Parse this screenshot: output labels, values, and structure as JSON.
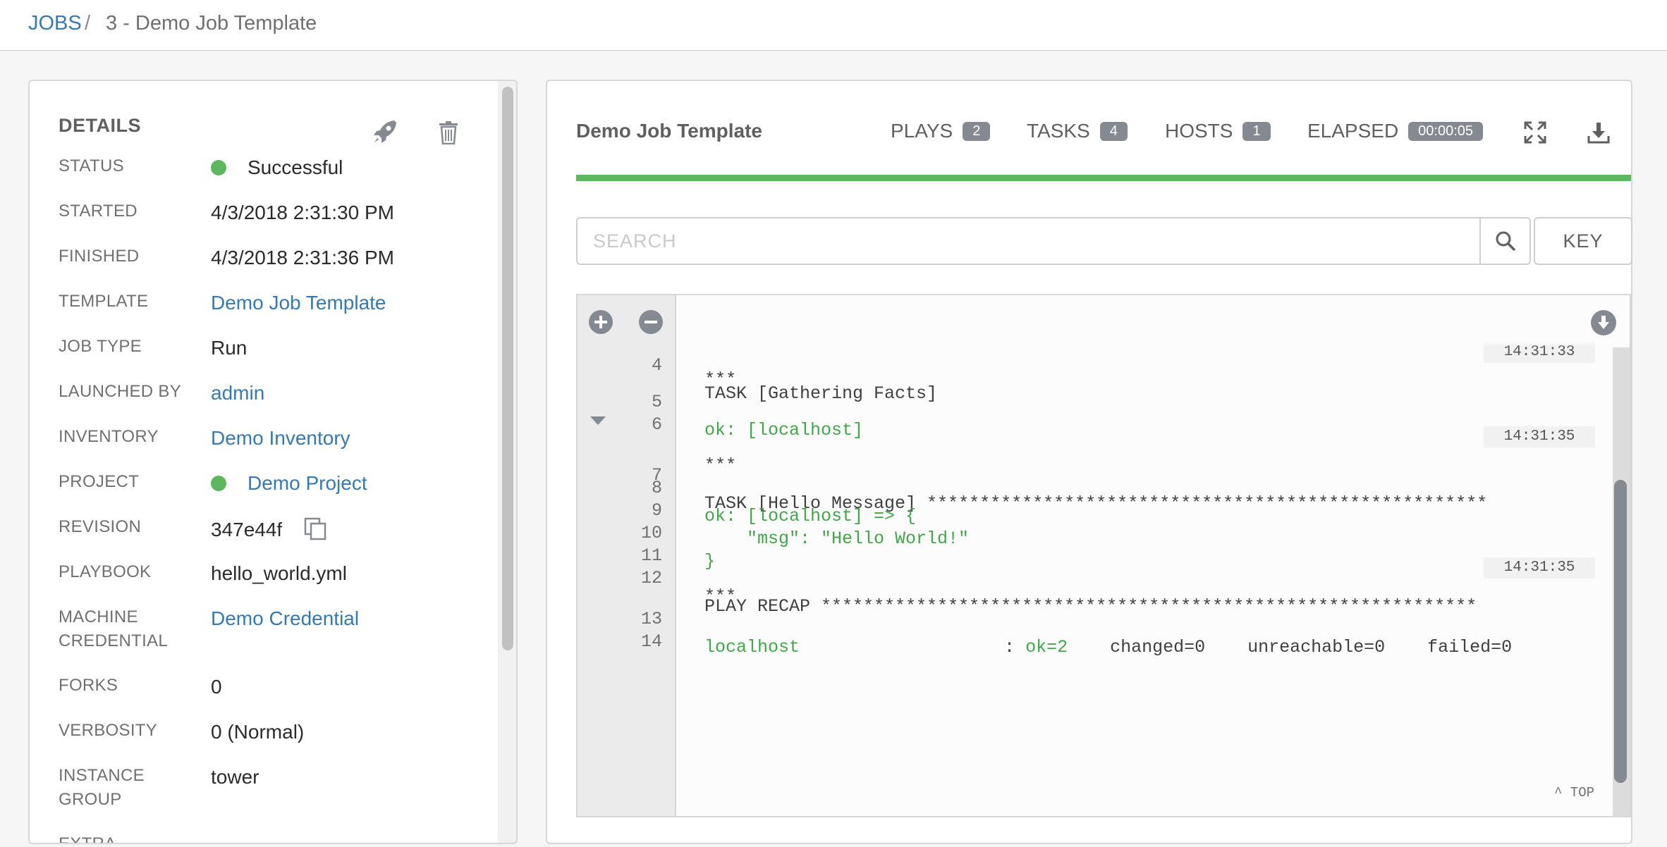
{
  "breadcrumb": {
    "root": "JOBS",
    "separator": "/",
    "current": "3 - Demo Job Template"
  },
  "details": {
    "title": "DETAILS",
    "rows": [
      {
        "label": "STATUS",
        "value": "Successful"
      },
      {
        "label": "STARTED",
        "value": "4/3/2018 2:31:30 PM"
      },
      {
        "label": "FINISHED",
        "value": "4/3/2018 2:31:36 PM"
      },
      {
        "label": "TEMPLATE",
        "value": "Demo Job Template"
      },
      {
        "label": "JOB TYPE",
        "value": "Run"
      },
      {
        "label": "LAUNCHED BY",
        "value": "admin"
      },
      {
        "label": "INVENTORY",
        "value": "Demo Inventory"
      },
      {
        "label": "PROJECT",
        "value": "Demo Project"
      },
      {
        "label": "REVISION",
        "value": "347e44f"
      },
      {
        "label": "PLAYBOOK",
        "value": "hello_world.yml"
      },
      {
        "label": "MACHINE CREDENTIAL",
        "value": "Demo Credential"
      },
      {
        "label": "FORKS",
        "value": "0"
      },
      {
        "label": "VERBOSITY",
        "value": "0 (Normal)"
      },
      {
        "label": "INSTANCE GROUP",
        "value": "tower"
      },
      {
        "label": "EXTRA VARIABLES",
        "value": ""
      }
    ]
  },
  "output": {
    "title": "Demo Job Template",
    "stats": [
      {
        "label": "PLAYS",
        "value": "2"
      },
      {
        "label": "TASKS",
        "value": "4"
      },
      {
        "label": "HOSTS",
        "value": "1"
      },
      {
        "label": "ELAPSED",
        "value": "00:00:05"
      }
    ],
    "progress": 1.0,
    "search": {
      "placeholder": "SEARCH",
      "value": ""
    },
    "key_label": "KEY",
    "top_label": "^ TOP",
    "lines": [
      {
        "n": "4",
        "text": "TASK [Gathering Facts]"
      },
      {
        "n": "",
        "text": "***",
        "ts": "14:31:33"
      },
      {
        "n": "5",
        "text": "ok: [localhost]"
      },
      {
        "n": "6",
        "text": ""
      },
      {
        "n": "7",
        "text": "TASK [Hello Message] *****************************************************"
      },
      {
        "n": "",
        "text": "***",
        "ts": "14:31:35"
      },
      {
        "n": "8",
        "text": "ok: [localhost] => {"
      },
      {
        "n": "9",
        "text": "    \"msg\": \"Hello World!\""
      },
      {
        "n": "10",
        "text": "}"
      },
      {
        "n": "11",
        "text": ""
      },
      {
        "n": "12",
        "text": "PLAY RECAP **************************************************************"
      },
      {
        "n": "",
        "text": "***",
        "ts": "14:31:35"
      },
      {
        "n": "13",
        "host": "localhost",
        "colon": ":",
        "ok": "ok=2",
        "rest": "    changed=0    unreachable=0    failed=0"
      },
      {
        "n": "14",
        "text": ""
      }
    ]
  },
  "colors": {
    "success": "#5cb85c",
    "link": "#337ab7",
    "badge": "#848992"
  }
}
